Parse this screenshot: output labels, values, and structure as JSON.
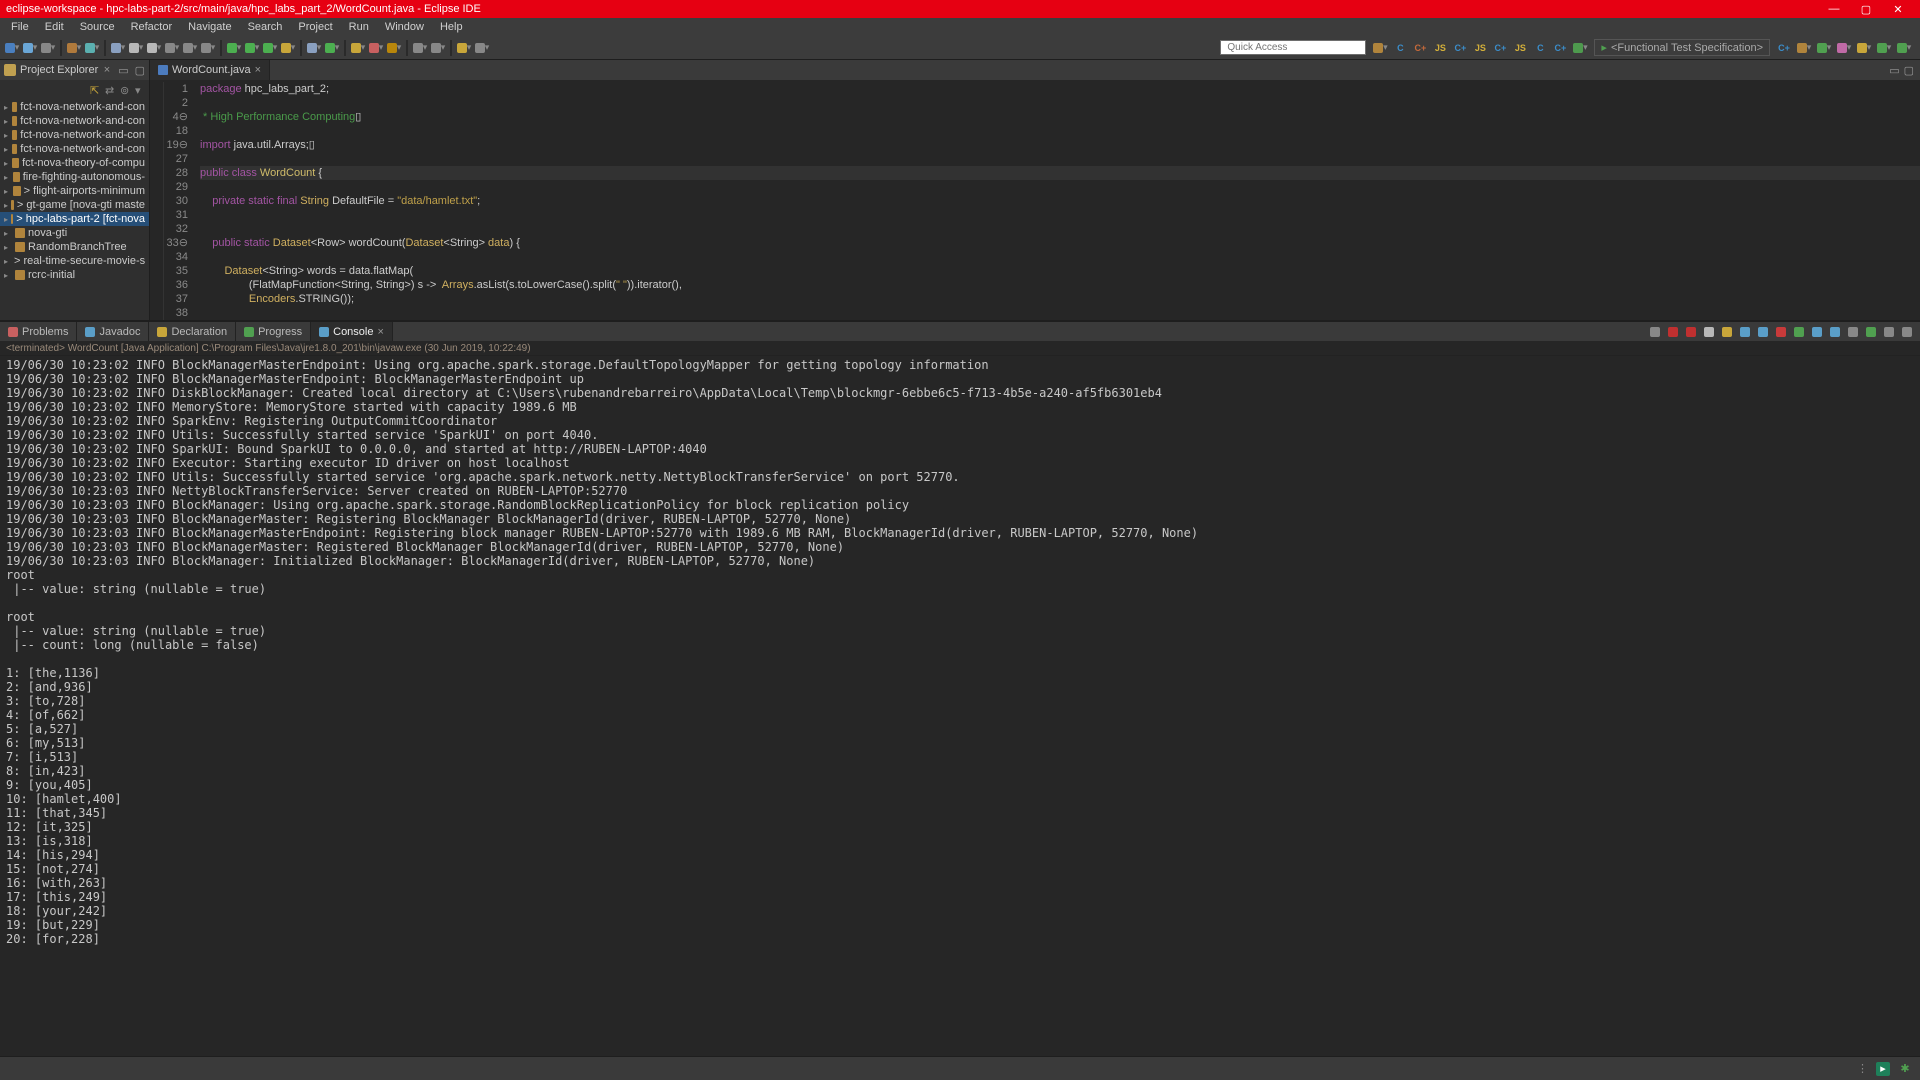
{
  "title": "eclipse-workspace - hpc-labs-part-2/src/main/java/hpc_labs_part_2/WordCount.java - Eclipse IDE",
  "menu": [
    "File",
    "Edit",
    "Source",
    "Refactor",
    "Navigate",
    "Search",
    "Project",
    "Run",
    "Window",
    "Help"
  ],
  "quick_access_placeholder": "Quick Access",
  "perspective_fts": "<Functional Test Specification>",
  "project_explorer": {
    "label": "Project Explorer",
    "items": [
      {
        "t": "fct-nova-network-and-con"
      },
      {
        "t": "fct-nova-network-and-con"
      },
      {
        "t": "fct-nova-network-and-con"
      },
      {
        "t": "fct-nova-network-and-con"
      },
      {
        "t": "fct-nova-theory-of-compu"
      },
      {
        "t": "fire-fighting-autonomous-"
      },
      {
        "t": "> flight-airports-minimum"
      },
      {
        "t": "> gt-game [nova-gti maste"
      },
      {
        "t": "> hpc-labs-part-2 [fct-nova",
        "sel": true
      },
      {
        "t": "nova-gti"
      },
      {
        "t": "RandomBranchTree"
      },
      {
        "t": "> real-time-secure-movie-s"
      },
      {
        "t": "rcrc-initial"
      }
    ]
  },
  "editor_tab": {
    "name": "WordCount.java"
  },
  "code_lines": [
    {
      "n": "1",
      "html": "<span class='tok-k'>package</span> hpc_labs_part_2;"
    },
    {
      "n": "2",
      "html": ""
    },
    {
      "n": "4⊖",
      "html": "<span class='tok-c'> * High Performance Computing</span>▯"
    },
    {
      "n": "18",
      "html": ""
    },
    {
      "n": "19⊖",
      "html": "<span class='tok-k'>import</span> java.util.Arrays;▯"
    },
    {
      "n": "27",
      "html": ""
    },
    {
      "n": "28",
      "html": "<span class='tok-k'>public class</span> <span class='tok-cl'>WordCount</span> {",
      "hl": true
    },
    {
      "n": "29",
      "html": ""
    },
    {
      "n": "30",
      "html": "    <span class='tok-k'>private static final</span> <span class='tok-ty'>String</span> DefaultFile = <span class='tok-s'>\"data/hamlet.txt\"</span>;"
    },
    {
      "n": "31",
      "html": ""
    },
    {
      "n": "32",
      "html": ""
    },
    {
      "n": "33⊖",
      "html": "    <span class='tok-k'>public static</span> <span class='tok-ty'>Dataset</span>&lt;Row&gt; wordCount(<span class='tok-ty'>Dataset</span>&lt;String&gt; <span class='tok-ty'>data</span>) {"
    },
    {
      "n": "34",
      "html": ""
    },
    {
      "n": "35",
      "html": "        <span class='tok-ty'>Dataset</span>&lt;String&gt; words = data.<span class='tok-t'>flatMap</span>("
    },
    {
      "n": "36",
      "html": "                (FlatMapFunction&lt;String, String&gt;) s -&gt;  <span class='tok-ty'>Arrays</span>.asList(s.toLowerCase().split(<span class='tok-s'>\" \"</span>)).iterator(),"
    },
    {
      "n": "37",
      "html": "                <span class='tok-ty'>Encoders</span>.STRING());"
    },
    {
      "n": "38",
      "html": ""
    }
  ],
  "tabs_bottom": [
    "Problems",
    "Javadoc",
    "Declaration",
    "Progress",
    "Console"
  ],
  "tabs_bottom_active": 4,
  "console_desc": "<terminated> WordCount [Java Application] C:\\Program Files\\Java\\jre1.8.0_201\\bin\\javaw.exe (30 Jun 2019, 10:22:49)",
  "console_text": "19/06/30 10:23:02 INFO BlockManagerMasterEndpoint: Using org.apache.spark.storage.DefaultTopologyMapper for getting topology information\n19/06/30 10:23:02 INFO BlockManagerMasterEndpoint: BlockManagerMasterEndpoint up\n19/06/30 10:23:02 INFO DiskBlockManager: Created local directory at C:\\Users\\rubenandrebarreiro\\AppData\\Local\\Temp\\blockmgr-6ebbe6c5-f713-4b5e-a240-af5fb6301eb4\n19/06/30 10:23:02 INFO MemoryStore: MemoryStore started with capacity 1989.6 MB\n19/06/30 10:23:02 INFO SparkEnv: Registering OutputCommitCoordinator\n19/06/30 10:23:02 INFO Utils: Successfully started service 'SparkUI' on port 4040.\n19/06/30 10:23:02 INFO SparkUI: Bound SparkUI to 0.0.0.0, and started at http://RUBEN-LAPTOP:4040\n19/06/30 10:23:02 INFO Executor: Starting executor ID driver on host localhost\n19/06/30 10:23:02 INFO Utils: Successfully started service 'org.apache.spark.network.netty.NettyBlockTransferService' on port 52770.\n19/06/30 10:23:03 INFO NettyBlockTransferService: Server created on RUBEN-LAPTOP:52770\n19/06/30 10:23:03 INFO BlockManager: Using org.apache.spark.storage.RandomBlockReplicationPolicy for block replication policy\n19/06/30 10:23:03 INFO BlockManagerMaster: Registering BlockManager BlockManagerId(driver, RUBEN-LAPTOP, 52770, None)\n19/06/30 10:23:03 INFO BlockManagerMasterEndpoint: Registering block manager RUBEN-LAPTOP:52770 with 1989.6 MB RAM, BlockManagerId(driver, RUBEN-LAPTOP, 52770, None)\n19/06/30 10:23:03 INFO BlockManagerMaster: Registered BlockManager BlockManagerId(driver, RUBEN-LAPTOP, 52770, None)\n19/06/30 10:23:03 INFO BlockManager: Initialized BlockManager: BlockManagerId(driver, RUBEN-LAPTOP, 52770, None)\nroot\n |-- value: string (nullable = true)\n\nroot\n |-- value: string (nullable = true)\n |-- count: long (nullable = false)\n\n1: [the,1136]\n2: [and,936]\n3: [to,728]\n4: [of,662]\n5: [a,527]\n6: [my,513]\n7: [i,513]\n8: [in,423]\n9: [you,405]\n10: [hamlet,400]\n11: [that,345]\n12: [it,325]\n13: [is,318]\n14: [his,294]\n15: [not,274]\n16: [with,263]\n17: [this,249]\n18: [your,242]\n19: [but,229]\n20: [for,228]",
  "toolbar_icons": [
    {
      "c": "#4a7fbf",
      "name": "new-icon"
    },
    {
      "c": "#6aa6d6",
      "name": "save-icon"
    },
    {
      "c": "#888",
      "name": "save-all-icon"
    },
    {
      "sep": true
    },
    {
      "c": "#b07a3c",
      "name": "open-icon"
    },
    {
      "c": "#5bb0b0",
      "name": "open-type-icon"
    },
    {
      "sep": true
    },
    {
      "c": "#8aa0c0",
      "name": "link-icon"
    },
    {
      "c": "#b8b8b8",
      "name": "undo-icon"
    },
    {
      "c": "#b8b8b8",
      "name": "redo-icon"
    },
    {
      "c": "#888",
      "name": "a-icon"
    },
    {
      "c": "#888",
      "name": "b-icon"
    },
    {
      "c": "#888",
      "name": "c-icon"
    },
    {
      "sep": true
    },
    {
      "c": "#4caf50",
      "name": "debug-icon"
    },
    {
      "c": "#4caf50",
      "name": "run-icon"
    },
    {
      "c": "#4caf50",
      "name": "coverage-icon"
    },
    {
      "c": "#c8a63a",
      "name": "run-last-icon"
    },
    {
      "sep": true
    },
    {
      "c": "#8aa0c0",
      "name": "ext-tools-icon"
    },
    {
      "c": "#4caf50",
      "name": "new-java-icon"
    },
    {
      "sep": true
    },
    {
      "c": "#c8a63a",
      "name": "search-icon"
    },
    {
      "c": "#c86060",
      "name": "toggle-icon"
    },
    {
      "c": "#b8860b",
      "name": "magnify-icon"
    },
    {
      "sep": true
    },
    {
      "c": "#888",
      "name": "nav-icon"
    },
    {
      "c": "#888",
      "name": "nav2-icon"
    },
    {
      "sep": true
    },
    {
      "c": "#c8a63a",
      "name": "back-icon"
    },
    {
      "c": "#888",
      "name": "forward-icon"
    }
  ],
  "persp_icons": [
    {
      "c": "#b0843c",
      "name": "open-perspective-icon"
    },
    {
      "c": "#3b8ecb",
      "name": "c-icon",
      "t": "C"
    },
    {
      "c": "#c86a3a",
      "name": "cpp-icon",
      "t": "C+"
    },
    {
      "c": "#d4b03a",
      "name": "js-icon",
      "t": "JS"
    },
    {
      "c": "#3b8ecb",
      "name": "c2-icon",
      "t": "C+"
    },
    {
      "c": "#d4b03a",
      "name": "js2-icon",
      "t": "JS"
    },
    {
      "c": "#3b8ecb",
      "name": "c3-icon",
      "t": "C+"
    },
    {
      "c": "#d4b03a",
      "name": "js3-icon",
      "t": "JS"
    },
    {
      "c": "#3b8ecb",
      "name": "c4-icon",
      "t": "C"
    },
    {
      "c": "#3b8ecb",
      "name": "c5-icon",
      "t": "C+"
    },
    {
      "c": "#4e9a4e",
      "name": "bug-icon"
    }
  ],
  "persp_icons2": [
    {
      "c": "#3b8ecb",
      "name": "cpersp-icon",
      "t": "C+"
    },
    {
      "c": "#b0843c",
      "name": "java-persp-icon"
    },
    {
      "c": "#50a050",
      "name": "debug-persp-icon"
    },
    {
      "c": "#c06aa6",
      "name": "git-persp-icon"
    },
    {
      "c": "#c8a63a",
      "name": "x-persp-icon"
    },
    {
      "c": "#50a050",
      "name": "bug2-persp-icon"
    },
    {
      "c": "#50a050",
      "name": "bug3-persp-icon"
    }
  ],
  "console_toolbar": [
    {
      "c": "#888",
      "name": "terminate-icon"
    },
    {
      "c": "#c03030",
      "name": "remove-icon"
    },
    {
      "c": "#c03030",
      "name": "remove-all-icon"
    },
    {
      "c": "#b8b8b8",
      "name": "clear-icon"
    },
    {
      "c": "#c8a63a",
      "name": "scroll-lock-icon"
    },
    {
      "c": "#5a9ec8",
      "name": "word-wrap-icon"
    },
    {
      "c": "#5a9ec8",
      "name": "pin-icon"
    },
    {
      "c": "#c83a3a",
      "name": "display-icon"
    },
    {
      "c": "#50a050",
      "name": "open-console-icon"
    },
    {
      "c": "#5a9ec8",
      "name": "m1-icon"
    },
    {
      "c": "#5a9ec8",
      "name": "m2-icon"
    },
    {
      "c": "#888",
      "name": "m3-icon"
    },
    {
      "c": "#50a050",
      "name": "m4-icon"
    },
    {
      "c": "#888",
      "name": "min-icon"
    },
    {
      "c": "#888",
      "name": "max-icon"
    }
  ]
}
